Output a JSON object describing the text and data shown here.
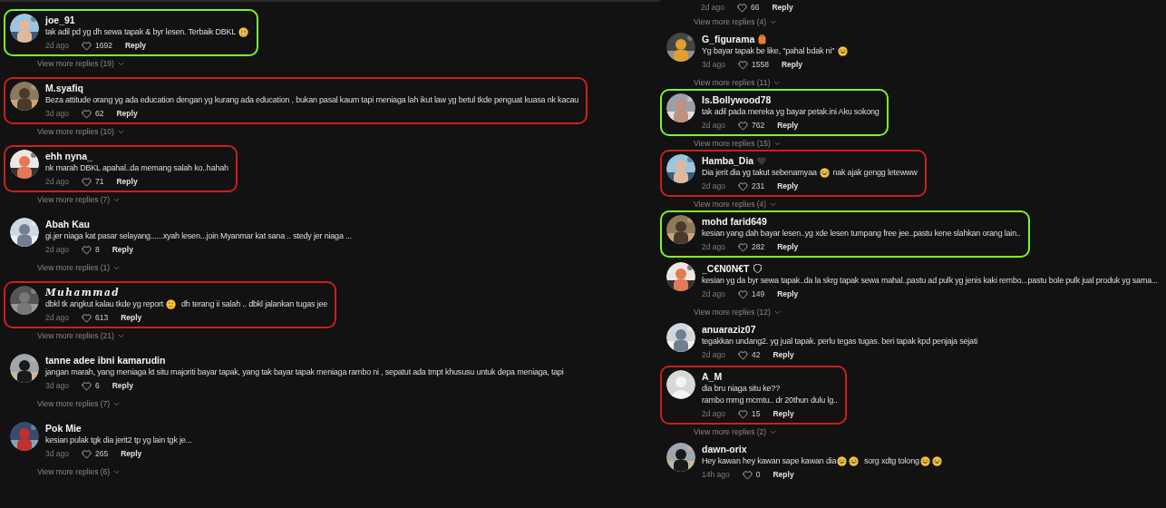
{
  "left_column": {
    "comments": [
      {
        "name": "joe_91",
        "lines": [
          [
            "tak adil pd yg dh sewa tapak & byr lesen. Terbaik DBKL ",
            {
              "kind": "grin"
            }
          ]
        ],
        "time": "2d ago",
        "likes": "1692",
        "reply": "Reply",
        "replies": "View more replies (19)",
        "color": "#7df52c"
      },
      {
        "name": "M.syafiq",
        "lines": [
          [
            "Beza attitude orang yg ada education dengan yg kurang ada education , bukan pasal kaum tapi meniaga lah ikut law yg betul tkde penguat kuasa nk kacau"
          ]
        ],
        "time": "3d ago",
        "likes": "62",
        "reply": "Reply",
        "replies": "View more replies (10)",
        "color": "#cc1f1f"
      },
      {
        "name": "ehh nyna_",
        "lines": [
          [
            "nk marah DBKL apahal..da memang salah ko..hahah"
          ]
        ],
        "time": "2d ago",
        "likes": "71",
        "reply": "Reply",
        "replies": "View more replies (7)",
        "color": "#cc1f1f"
      },
      {
        "name": "Abah Kau",
        "lines": [
          [
            "gi.jer niaga kat pasar selayang......xyah lesen...join Myanmar kat sana .. stedy jer niaga ..."
          ]
        ],
        "time": "2d ago",
        "likes": "8",
        "reply": "Reply",
        "replies": "View more replies (1)"
      },
      {
        "name": "Muhammad",
        "script": true,
        "lines": [
          [
            "dbkl tk angkut kalau tkde yg report ",
            {
              "kind": "sad"
            },
            "  dh terang ii salah .. dbkl jalankan tugas jee"
          ]
        ],
        "time": "2d ago",
        "likes": "613",
        "reply": "Reply",
        "replies": "View more replies (21)",
        "color": "#cc1f1f"
      },
      {
        "name": "tanne adee ibni kamarudin",
        "lines": [
          [
            "jangan marah, yang meniaga kt situ majoriti bayar tapak, yang tak bayar tapak meniaga rambo ni , sepatut ada tmpt khususu untuk depa meniaga, tapi"
          ]
        ],
        "time": "3d ago",
        "likes": "6",
        "reply": "Reply",
        "replies": "View more replies (7)"
      },
      {
        "name": "Pok Mie",
        "lines": [
          [
            "kesian pulak tgk dia jerit2 tp yg lain tgk je..."
          ]
        ],
        "time": "3d ago",
        "likes": "265",
        "reply": "Reply",
        "replies": "View more replies (6)"
      }
    ]
  },
  "right_column": {
    "cut_comment": {
      "time": "2d ago",
      "likes": "66",
      "reply": "Reply",
      "replies": "View more replies (4)"
    },
    "comments": [
      {
        "name": "G_figurama",
        "badge": {
          "kind": "jar"
        },
        "lines": [
          [
            "Yg bayar tapak be like, \"pahal bdak ni\" ",
            {
              "kind": "laugh"
            }
          ]
        ],
        "time": "3d ago",
        "likes": "1558",
        "reply": "Reply",
        "replies": "View more replies (11)"
      },
      {
        "name": "Is.Bollywood78",
        "lines": [
          [
            "tak adil pada mereka yg bayar petak.ini Aku sokong"
          ]
        ],
        "time": "2d ago",
        "likes": "762",
        "reply": "Reply",
        "replies": "View more replies (15)",
        "color": "#7df52c"
      },
      {
        "name": "Hamba_Dia",
        "badge": {
          "kind": "heart"
        },
        "lines": [
          [
            "Dia jerit dia yg takut sebenarnyaa ",
            {
              "kind": "laugh"
            },
            " nak ajak gengg letewww"
          ]
        ],
        "time": "2d ago",
        "likes": "231",
        "reply": "Reply",
        "replies": "View more replies (4)",
        "color": "#cc1f1f"
      },
      {
        "name": "mohd farid649",
        "lines": [
          [
            "kesian yang dah bayar lesen..yg xde lesen tumpang free jee..pastu kene slahkan orang lain.."
          ]
        ],
        "time": "2d ago",
        "likes": "282",
        "reply": "Reply",
        "color": "#7df52c"
      },
      {
        "name": "_C€N0N€T",
        "badge": {
          "kind": "shield"
        },
        "lines": [
          [
            "kesian yg da byr sewa tapak..da la skrg tapak sewa mahal..pastu ad pulk yg jenis kaki rembo...pastu bole pulk jual produk yg sama..."
          ]
        ],
        "time": "2d ago",
        "likes": "149",
        "reply": "Reply",
        "replies": "View more replies (12)"
      },
      {
        "name": "anuaraziz07",
        "lines": [
          [
            "tegakkan undang2. yg jual tapak. perlu tegas tugas. beri tapak kpd penjaja sejati"
          ]
        ],
        "time": "2d ago",
        "likes": "42",
        "reply": "Reply"
      },
      {
        "name": "A_M",
        "kind": "default",
        "lines": [
          [
            "dia bru niaga situ ke??"
          ],
          [
            "rambo mmg mcmtu.. dr 20thun dulu lg.."
          ]
        ],
        "time": "2d ago",
        "likes": "15",
        "reply": "Reply",
        "replies": "View more replies (2)",
        "color": "#cc1f1f"
      },
      {
        "name": "dawn-orix",
        "lines": [
          [
            "Hey kawan hey kawan sape kawan dia",
            {
              "kind": "laugh"
            },
            {
              "kind": "laugh"
            },
            "  sorg xdtg tolong",
            {
              "kind": "laugh"
            },
            {
              "kind": "laugh"
            }
          ]
        ],
        "time": "14h ago",
        "likes": "0",
        "reply": "Reply"
      }
    ]
  }
}
